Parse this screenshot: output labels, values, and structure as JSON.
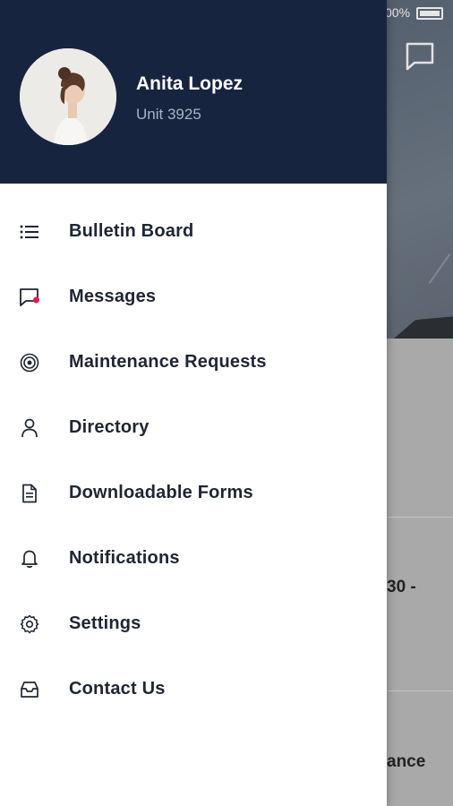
{
  "status_bar": {
    "battery_text": "00%"
  },
  "user": {
    "name": "Anita Lopez",
    "unit": "Unit 3925"
  },
  "menu": {
    "items": [
      {
        "label": "Bulletin Board",
        "icon": "list-icon"
      },
      {
        "label": "Messages",
        "icon": "message-icon"
      },
      {
        "label": "Maintenance Requests",
        "icon": "target-icon"
      },
      {
        "label": "Directory",
        "icon": "person-icon"
      },
      {
        "label": "Downloadable Forms",
        "icon": "document-icon"
      },
      {
        "label": "Notifications",
        "icon": "bell-icon"
      },
      {
        "label": "Settings",
        "icon": "gear-icon"
      },
      {
        "label": "Contact Us",
        "icon": "inbox-icon"
      }
    ]
  },
  "background": {
    "partial_text_1": "30 -",
    "partial_text_2": "ance"
  },
  "colors": {
    "header": "#172440",
    "accent": "#e8194a",
    "text": "#1f2533"
  }
}
